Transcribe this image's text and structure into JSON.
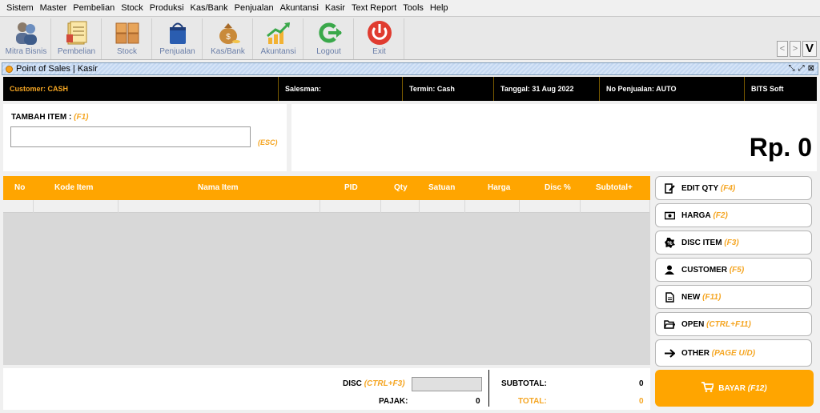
{
  "menu": [
    "Sistem",
    "Master",
    "Pembelian",
    "Stock",
    "Produksi",
    "Kas/Bank",
    "Penjualan",
    "Akuntansi",
    "Kasir",
    "Text Report",
    "Tools",
    "Help"
  ],
  "toolbar": [
    {
      "label": "Mitra Bisnis",
      "icon": "users-icon"
    },
    {
      "label": "Pembelian",
      "icon": "ledger-icon"
    },
    {
      "label": "Stock",
      "icon": "boxes-icon"
    },
    {
      "label": "Penjualan",
      "icon": "shopping-bag-icon"
    },
    {
      "label": "Kas/Bank",
      "icon": "money-bag-icon"
    },
    {
      "label": "Akuntansi",
      "icon": "growth-chart-icon"
    },
    {
      "label": "Logout",
      "icon": "logout-arrow-icon"
    },
    {
      "label": "Exit",
      "icon": "power-icon"
    }
  ],
  "nav": {
    "prev": "<",
    "next": ">",
    "v": "V"
  },
  "window_title": "Point of Sales | Kasir",
  "info": {
    "customer": "Customer: CASH",
    "salesman": "Salesman:",
    "termin": "Termin: Cash",
    "tanggal": "Tanggal: 31 Aug 2022",
    "no_penjualan": "No Penjualan: AUTO",
    "brand": "BITS Soft"
  },
  "input": {
    "label": "TAMBAH ITEM :",
    "hotkey": "(F1)",
    "esc": "(ESC)",
    "value": "",
    "placeholder": ""
  },
  "total_display": "Rp. 0",
  "table": {
    "headers": [
      "No",
      "Kode Item",
      "Nama Item",
      "PID",
      "Qty",
      "Satuan",
      "Harga",
      "Disc %",
      "Subtotal+"
    ]
  },
  "side_buttons": [
    {
      "label": "EDIT QTY",
      "hotkey": "(F4)",
      "icon": "edit-icon"
    },
    {
      "label": "HARGA",
      "hotkey": "(F2)",
      "icon": "money-icon"
    },
    {
      "label": "DISC ITEM",
      "hotkey": "(F3)",
      "icon": "badge-percent-icon"
    },
    {
      "label": "CUSTOMER",
      "hotkey": "(F5)",
      "icon": "person-icon"
    },
    {
      "label": "NEW",
      "hotkey": "(F11)",
      "icon": "new-file-icon"
    },
    {
      "label": "OPEN",
      "hotkey": "(CTRL+F11)",
      "icon": "folder-open-icon"
    },
    {
      "label": "OTHER",
      "hotkey": "(PAGE U/D)",
      "icon": "arrow-right-icon"
    }
  ],
  "bottom": {
    "disc_label": "DISC",
    "disc_hotkey": "(CTRL+F3)",
    "pajak_label": "PAJAK:",
    "pajak_value": "0",
    "subtotal_label": "SUBTOTAL:",
    "subtotal_value": "0",
    "total_label": "TOTAL:",
    "total_value": "0"
  },
  "bayar": {
    "label": "BAYAR",
    "hotkey": "(F12)",
    "icon": "cart-icon"
  },
  "colors": {
    "accent": "#ffa500",
    "info_bg": "#000000",
    "hotkey": "#f5a623"
  }
}
